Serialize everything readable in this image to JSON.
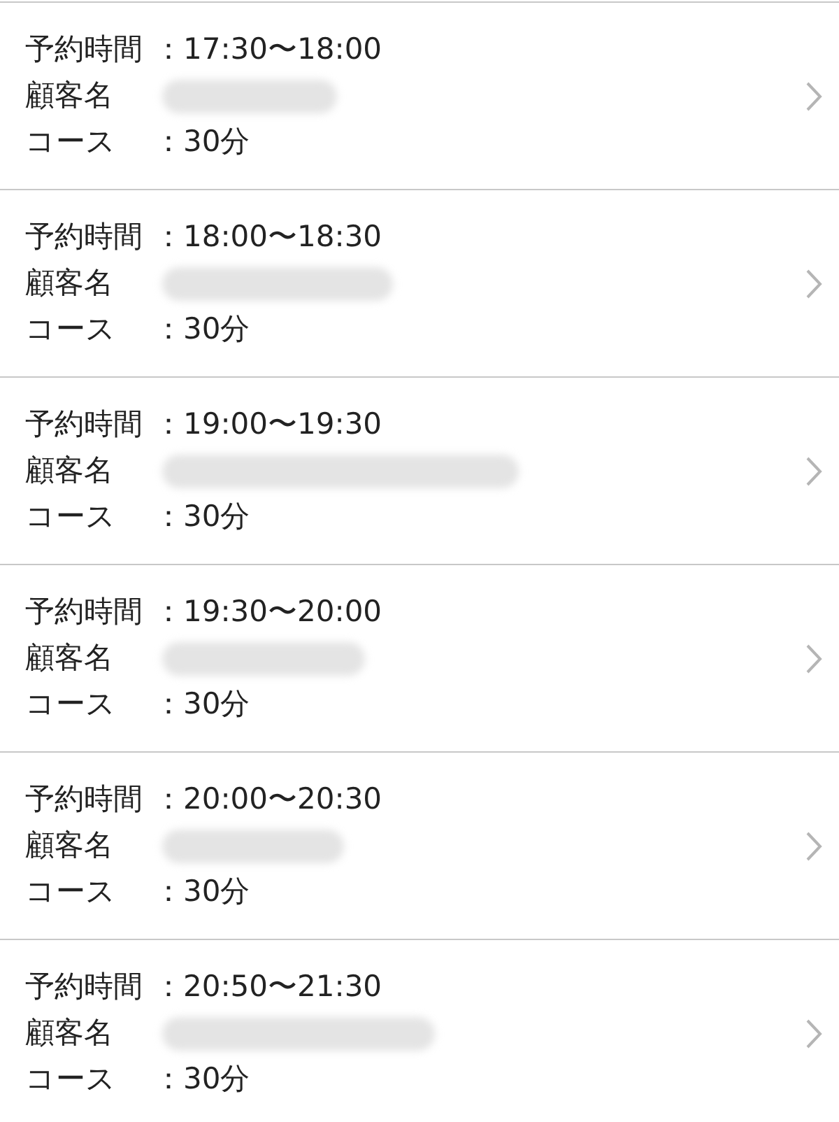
{
  "reservations": [
    {
      "fields": [
        {
          "kind": "text",
          "label": "予約時間",
          "value": "：17:30〜18:00"
        },
        {
          "kind": "redacted",
          "label": "顧客名"
        },
        {
          "kind": "text",
          "label": "コース",
          "value": "：30分"
        }
      ]
    },
    {
      "fields": [
        {
          "kind": "text",
          "label": "予約時間",
          "value": "：18:00〜18:30"
        },
        {
          "kind": "redacted",
          "label": "顧客名"
        },
        {
          "kind": "text",
          "label": "コース",
          "value": "：30分"
        }
      ]
    },
    {
      "fields": [
        {
          "kind": "text",
          "label": "予約時間",
          "value": "：19:00〜19:30"
        },
        {
          "kind": "redacted",
          "label": "顧客名"
        },
        {
          "kind": "text",
          "label": "コース",
          "value": "：30分"
        }
      ]
    },
    {
      "fields": [
        {
          "kind": "text",
          "label": "予約時間",
          "value": "：19:30〜20:00"
        },
        {
          "kind": "redacted",
          "label": "顧客名"
        },
        {
          "kind": "text",
          "label": "コース",
          "value": "：30分"
        }
      ]
    },
    {
      "fields": [
        {
          "kind": "text",
          "label": "予約時間",
          "value": "：20:00〜20:30"
        },
        {
          "kind": "redacted",
          "label": "顧客名"
        },
        {
          "kind": "text",
          "label": "コース",
          "value": "：30分"
        }
      ]
    },
    {
      "fields": [
        {
          "kind": "text",
          "label": "予約時間",
          "value": "：20:50〜21:30"
        },
        {
          "kind": "redacted",
          "label": "顧客名"
        },
        {
          "kind": "text",
          "label": "コース",
          "value": "：30分"
        }
      ]
    }
  ]
}
